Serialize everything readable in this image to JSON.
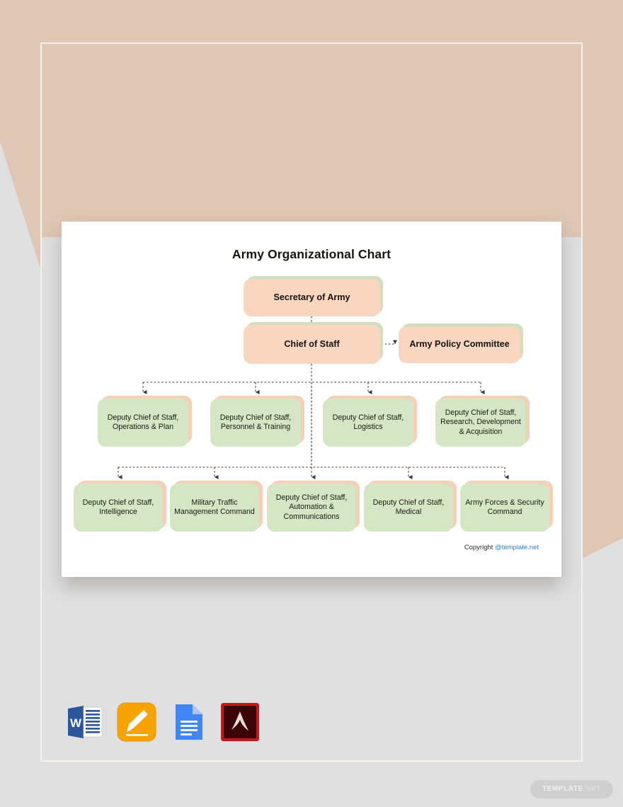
{
  "document": {
    "title": "Army Organizational Chart",
    "copyright_prefix": "Copyright ",
    "copyright_link": "@template.net"
  },
  "watermark": {
    "text_main": "TEMPLATE",
    "text_suffix": ".NET"
  },
  "formats": [
    {
      "name": "microsoft-word-icon",
      "label": "W"
    },
    {
      "name": "apple-pages-icon",
      "label": ""
    },
    {
      "name": "google-docs-icon",
      "label": ""
    },
    {
      "name": "adobe-pdf-icon",
      "label": ""
    }
  ],
  "colors": {
    "peach_node": "#F8D6BF",
    "green_node": "#D4E6C4",
    "peach_shadow": "#F6CFB6",
    "green_shadow": "#CFE0BD",
    "background_peach": "#E0C6B4",
    "background_gray": "#E0E0E0",
    "card": "#FFFFFF",
    "link_blue": "#2D7FD0",
    "connector": "#3A3A3A"
  },
  "chart_data": {
    "type": "diagram",
    "title": "Army Organizational Chart",
    "nodes": [
      {
        "id": "secretary",
        "label": "Secretary of Army",
        "level": 1,
        "style": "peach"
      },
      {
        "id": "chief",
        "label": "Chief of Staff",
        "level": 2,
        "style": "peach"
      },
      {
        "id": "policy",
        "label": "Army Policy Committee",
        "level": 2,
        "style": "peach"
      },
      {
        "id": "ops",
        "label": "Deputy Chief of Staff, Operations & Plan",
        "level": 3,
        "style": "green"
      },
      {
        "id": "personnel",
        "label": "Deputy Chief of Staff, Personnel & Training",
        "level": 3,
        "style": "green"
      },
      {
        "id": "logistics",
        "label": "Deputy Chief of Staff, Logistics",
        "level": 3,
        "style": "green"
      },
      {
        "id": "research",
        "label": "Deputy Chief of Staff, Research, Development & Acquisition",
        "level": 3,
        "style": "green"
      },
      {
        "id": "intel",
        "label": "Deputy Chief of Staff, Intelligence",
        "level": 4,
        "style": "green"
      },
      {
        "id": "traffic",
        "label": "Military Traffic Management Command",
        "level": 4,
        "style": "green"
      },
      {
        "id": "automation",
        "label": "Deputy Chief of Staff, Automation & Communications",
        "level": 4,
        "style": "green"
      },
      {
        "id": "medical",
        "label": "Deputy Chief of Staff, Medical",
        "level": 4,
        "style": "green"
      },
      {
        "id": "forces",
        "label": "Army Forces & Security Command",
        "level": 4,
        "style": "green"
      }
    ],
    "edges": [
      {
        "from": "secretary",
        "to": "chief",
        "style": "dashed-arrow"
      },
      {
        "from": "chief",
        "to": "policy",
        "style": "dashed-arrow"
      },
      {
        "from": "chief",
        "to": "ops",
        "style": "dashed-arrow"
      },
      {
        "from": "chief",
        "to": "personnel",
        "style": "dashed-arrow"
      },
      {
        "from": "chief",
        "to": "logistics",
        "style": "dashed-arrow"
      },
      {
        "from": "chief",
        "to": "research",
        "style": "dashed-arrow"
      },
      {
        "from": "chief",
        "to": "intel",
        "style": "dashed-arrow"
      },
      {
        "from": "chief",
        "to": "traffic",
        "style": "dashed-arrow"
      },
      {
        "from": "chief",
        "to": "automation",
        "style": "dashed-arrow"
      },
      {
        "from": "chief",
        "to": "medical",
        "style": "dashed-arrow"
      },
      {
        "from": "chief",
        "to": "forces",
        "style": "dashed-arrow"
      }
    ]
  }
}
